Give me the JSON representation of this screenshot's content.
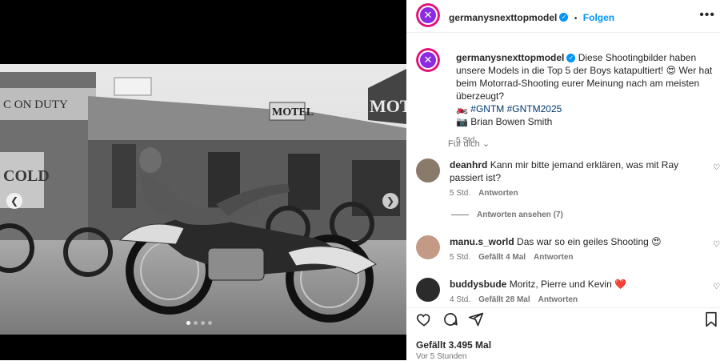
{
  "post": {
    "username": "germanysnexttopmodel",
    "follow_label": "Folgen",
    "dot_separator": "•",
    "caption_text": "Diese Shootingbilder haben unsere Models in die Top 5 der Boys katapultiert! 😍 Wer hat beim Motorrad-Shooting eurer Meinung nach am meisten überzeugt?",
    "hashtags_line": "🏍️ #GNTM #GNTM2025",
    "credit_line": "📷 Brian Bowen Smith",
    "caption_time": "5 Std.",
    "translate_label": "Für dich"
  },
  "comments": [
    {
      "username": "deanhrd",
      "text": "Kann mir bitte jemand erklären, was mit Ray passiert ist?",
      "time": "5 Std.",
      "likes": "",
      "reply": "Antworten"
    },
    {
      "username": "manu.s_world",
      "text": "Das war so ein geiles Shooting 😍",
      "time": "5 Std.",
      "likes": "Gefällt 4 Mal",
      "reply": "Antworten"
    },
    {
      "username": "buddysbude",
      "text": "Moritz, Pierre und Kevin ❤️",
      "time": "4 Std.",
      "likes": "Gefällt 28 Mal",
      "reply": "Antworten"
    }
  ],
  "replies_label": "Antworten ansehen (7)",
  "footer": {
    "likes": "Gefällt 3.495 Mal",
    "posted": "Vor 5 Stunden"
  },
  "photo_signs": {
    "left_sign": "C ON DUTY",
    "cold_sign": "COLD",
    "motel_small": "MOTEL",
    "motel_big": "MOTE"
  },
  "carousel": {
    "count": 4,
    "active_index": 0
  },
  "icons": [
    "chevron-left-icon",
    "chevron-right-icon",
    "heart-icon",
    "comment-icon",
    "share-icon",
    "bookmark-icon",
    "more-icon",
    "verified-icon"
  ]
}
